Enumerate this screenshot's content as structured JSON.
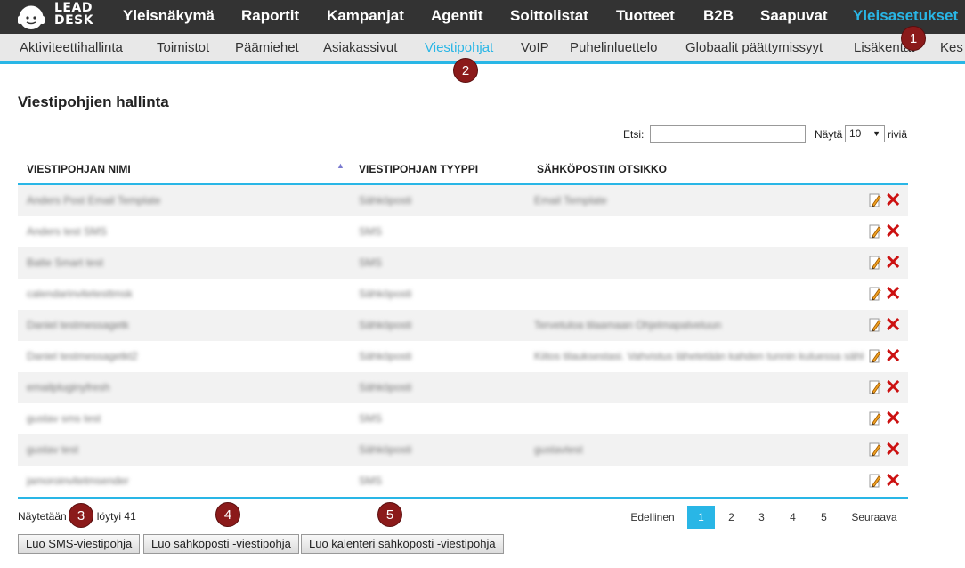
{
  "logo": {
    "line1": "LEAD",
    "line2": "DESK"
  },
  "topnav": [
    {
      "label": "Yleisnäkymä",
      "active": false
    },
    {
      "label": "Raportit",
      "active": false
    },
    {
      "label": "Kampanjat",
      "active": false
    },
    {
      "label": "Agentit",
      "active": false
    },
    {
      "label": "Soittolistat",
      "active": false
    },
    {
      "label": "Tuotteet",
      "active": false
    },
    {
      "label": "B2B",
      "active": false
    },
    {
      "label": "Saapuvat",
      "active": false
    },
    {
      "label": "Yleisasetukset",
      "active": true
    }
  ],
  "subnav": [
    {
      "label": "Aktiviteettihallinta",
      "active": false
    },
    {
      "label": "Toimistot",
      "active": false
    },
    {
      "label": "Päämiehet",
      "active": false
    },
    {
      "label": "Asiakassivut",
      "active": false
    },
    {
      "label": "Viestipohjat",
      "active": true
    },
    {
      "label": "VoIP",
      "active": false
    },
    {
      "label": "Puhelinluettelo",
      "active": false
    },
    {
      "label": "Globaalit päättymissyyt",
      "active": false
    },
    {
      "label": "Lisäkentät",
      "active": false
    },
    {
      "label": "Kes",
      "active": false
    }
  ],
  "badges": [
    "1",
    "2",
    "3",
    "4",
    "5"
  ],
  "page_title": "Viestipohjien hallinta",
  "search": {
    "label": "Etsi:",
    "value": ""
  },
  "length": {
    "label": "Näytä",
    "value": "10",
    "suffix": "riviä"
  },
  "table": {
    "columns": [
      "VIESTIPOHJAN NIMI",
      "VIESTIPOHJAN TYYPPI",
      "SÄHKÖPOSTIN OTSIKKO"
    ],
    "rows": [
      {
        "name": "Anders Post Email Template",
        "type": "Sähköposti",
        "subject": "Email Template"
      },
      {
        "name": "Anders test SMS",
        "type": "SMS",
        "subject": ""
      },
      {
        "name": "Batte Smart test",
        "type": "SMS",
        "subject": ""
      },
      {
        "name": "calendarinvitetesttmsk",
        "type": "Sähköposti",
        "subject": ""
      },
      {
        "name": "Daniel testmessagetk",
        "type": "Sähköposti",
        "subject": "Tervetuloa tilaamaan Ohjelmapalveluun"
      },
      {
        "name": "Daniel testmessagetkt2",
        "type": "Sähköposti",
        "subject": "Kiitos tilauksestasi. Vahvistus lähetetään kahden tunnin kuluessa sähköpostiisi"
      },
      {
        "name": "emailpluginyfresh",
        "type": "Sähköposti",
        "subject": ""
      },
      {
        "name": "gustav sms test",
        "type": "SMS",
        "subject": ""
      },
      {
        "name": "gustav test",
        "type": "Sähköposti",
        "subject": "gustavtest"
      },
      {
        "name": "jamoroinvitetmsender",
        "type": "SMS",
        "subject": ""
      }
    ]
  },
  "info_text": "Näytetään 1-10, löytyi 41",
  "pagination": {
    "prev": "Edellinen",
    "pages": [
      "1",
      "2",
      "3",
      "4",
      "5"
    ],
    "current": "1",
    "next": "Seuraava"
  },
  "buttons": {
    "sms": "Luo SMS-viestipohja",
    "email": "Luo sähköposti -viestipohja",
    "calendar": "Luo kalenteri sähköposti -viestipohja"
  },
  "colors": {
    "accent": "#29b6e6",
    "topbar": "#333333",
    "badge": "#8b1a1a",
    "delete": "#cc1111"
  },
  "icons": {
    "edit": "pencil-edit-icon",
    "delete": "red-x-delete-icon",
    "sort": "sort-asc-icon"
  }
}
